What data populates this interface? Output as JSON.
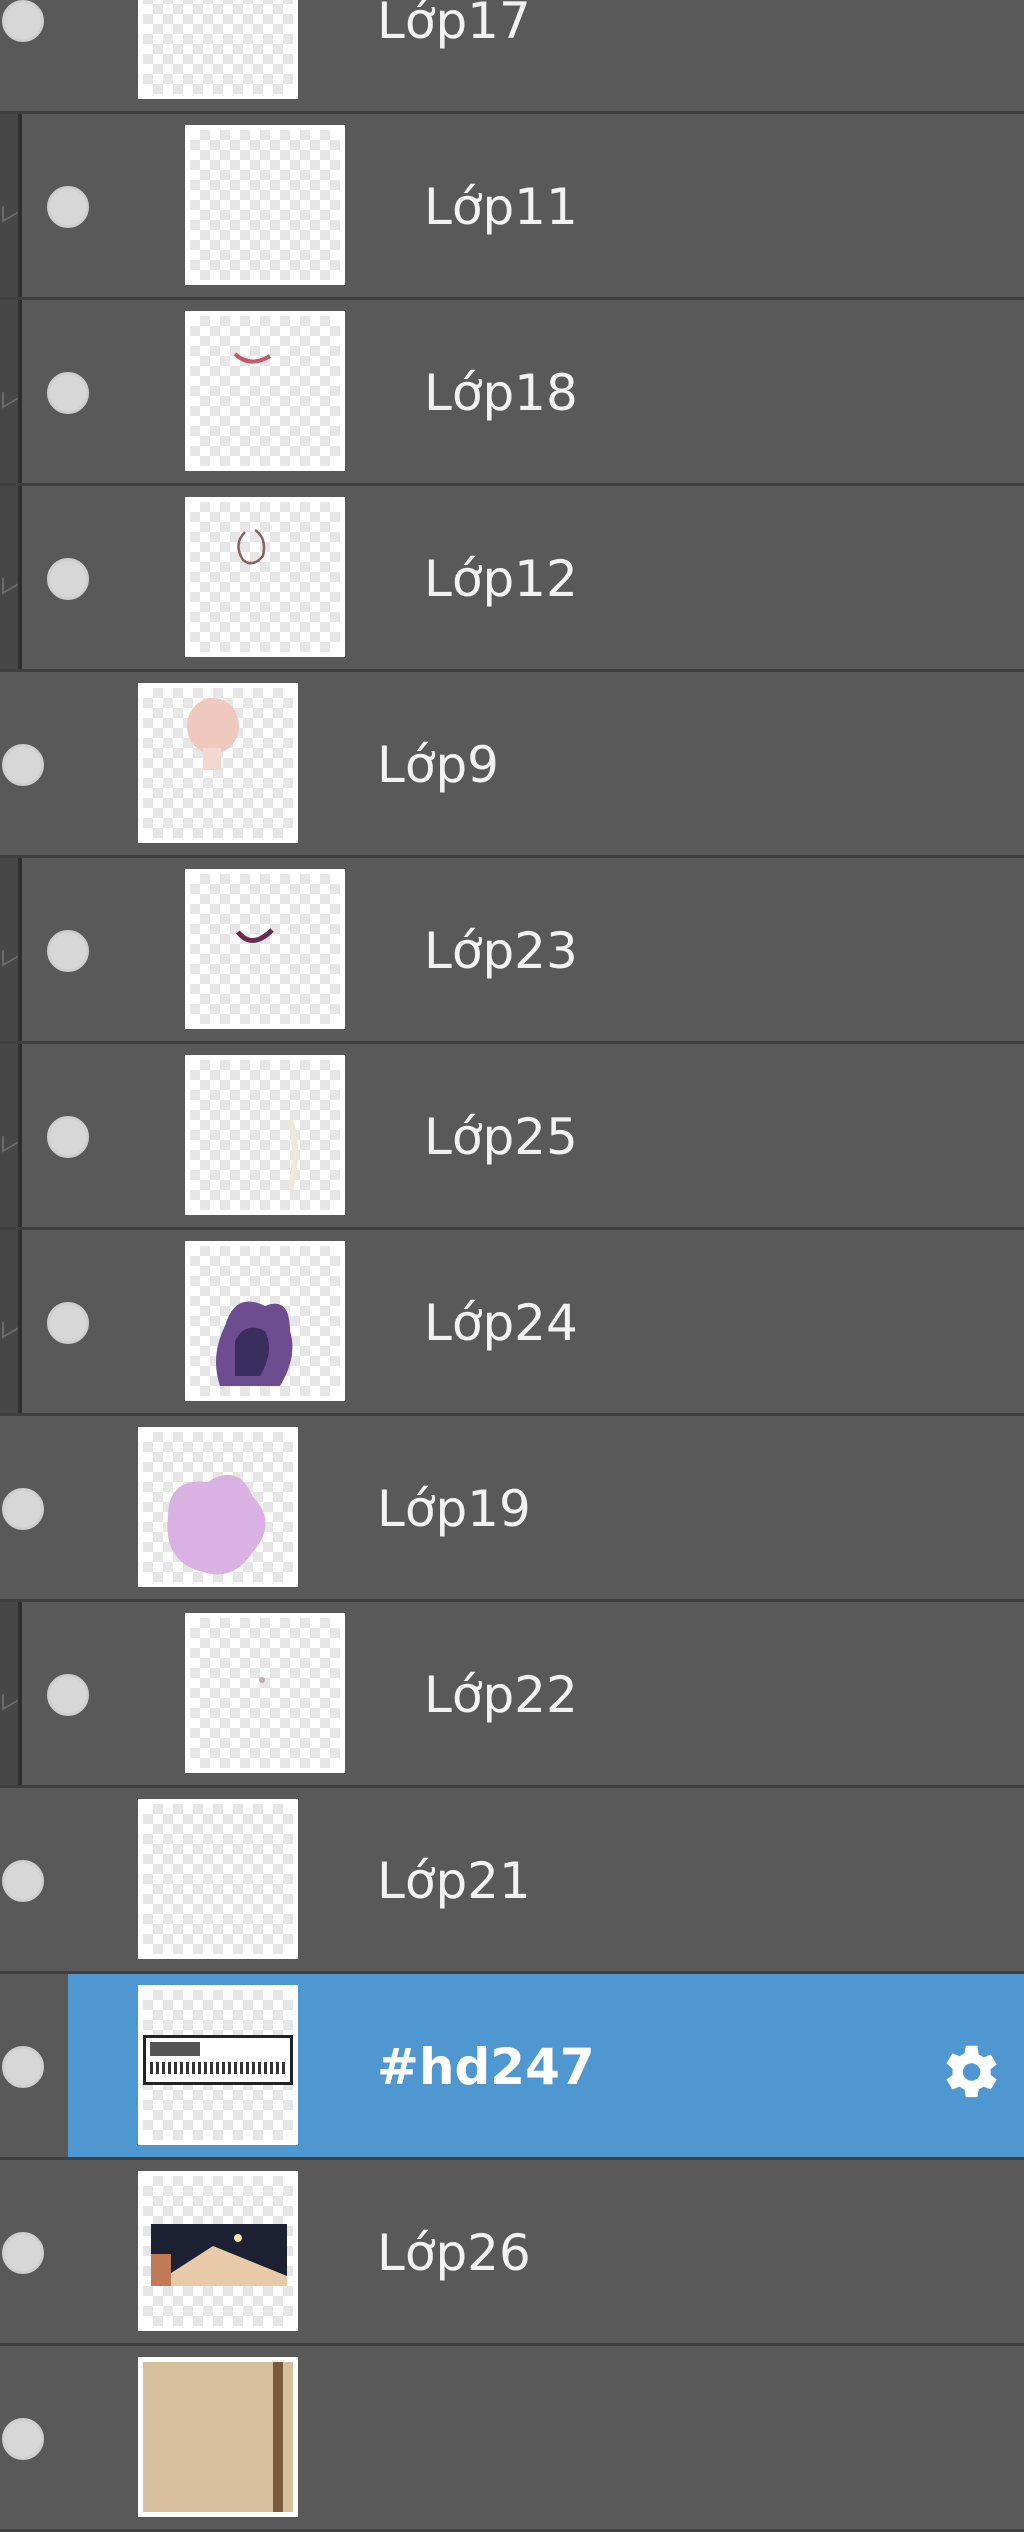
{
  "layers_panel": {
    "rows": [
      {
        "label": "Lớp17",
        "clipped": false,
        "selected": false,
        "thumb": "empty"
      },
      {
        "label": "Lớp11",
        "clipped": true,
        "selected": false,
        "thumb": "empty"
      },
      {
        "label": "Lớp18",
        "clipped": true,
        "selected": false,
        "thumb": "red-stroke"
      },
      {
        "label": "Lớp12",
        "clipped": true,
        "selected": false,
        "thumb": "outline-sketch"
      },
      {
        "label": "Lớp9",
        "clipped": false,
        "selected": false,
        "thumb": "skin-blob"
      },
      {
        "label": "Lớp23",
        "clipped": true,
        "selected": false,
        "thumb": "mouth-stroke"
      },
      {
        "label": "Lớp25",
        "clipped": true,
        "selected": false,
        "thumb": "faint-figure"
      },
      {
        "label": "Lớp24",
        "clipped": true,
        "selected": false,
        "thumb": "purple-hair"
      },
      {
        "label": "Lớp19",
        "clipped": false,
        "selected": false,
        "thumb": "lilac-blob"
      },
      {
        "label": "Lớp22",
        "clipped": true,
        "selected": false,
        "thumb": "tiny-dot"
      },
      {
        "label": "Lớp21",
        "clipped": false,
        "selected": false,
        "thumb": "empty"
      },
      {
        "label": "#hd247",
        "clipped": false,
        "selected": true,
        "thumb": "text-banner"
      },
      {
        "label": "Lớp26",
        "clipped": false,
        "selected": false,
        "thumb": "night-scene"
      },
      {
        "label": "",
        "clipped": false,
        "selected": false,
        "thumb": "beige-strip"
      }
    ],
    "settings_icon": "gear-icon",
    "colors": {
      "panel_bg": "#595959",
      "separator": "#3f3f3f",
      "selected_bg": "#4f97d1",
      "label": "#f2f2f2"
    }
  }
}
